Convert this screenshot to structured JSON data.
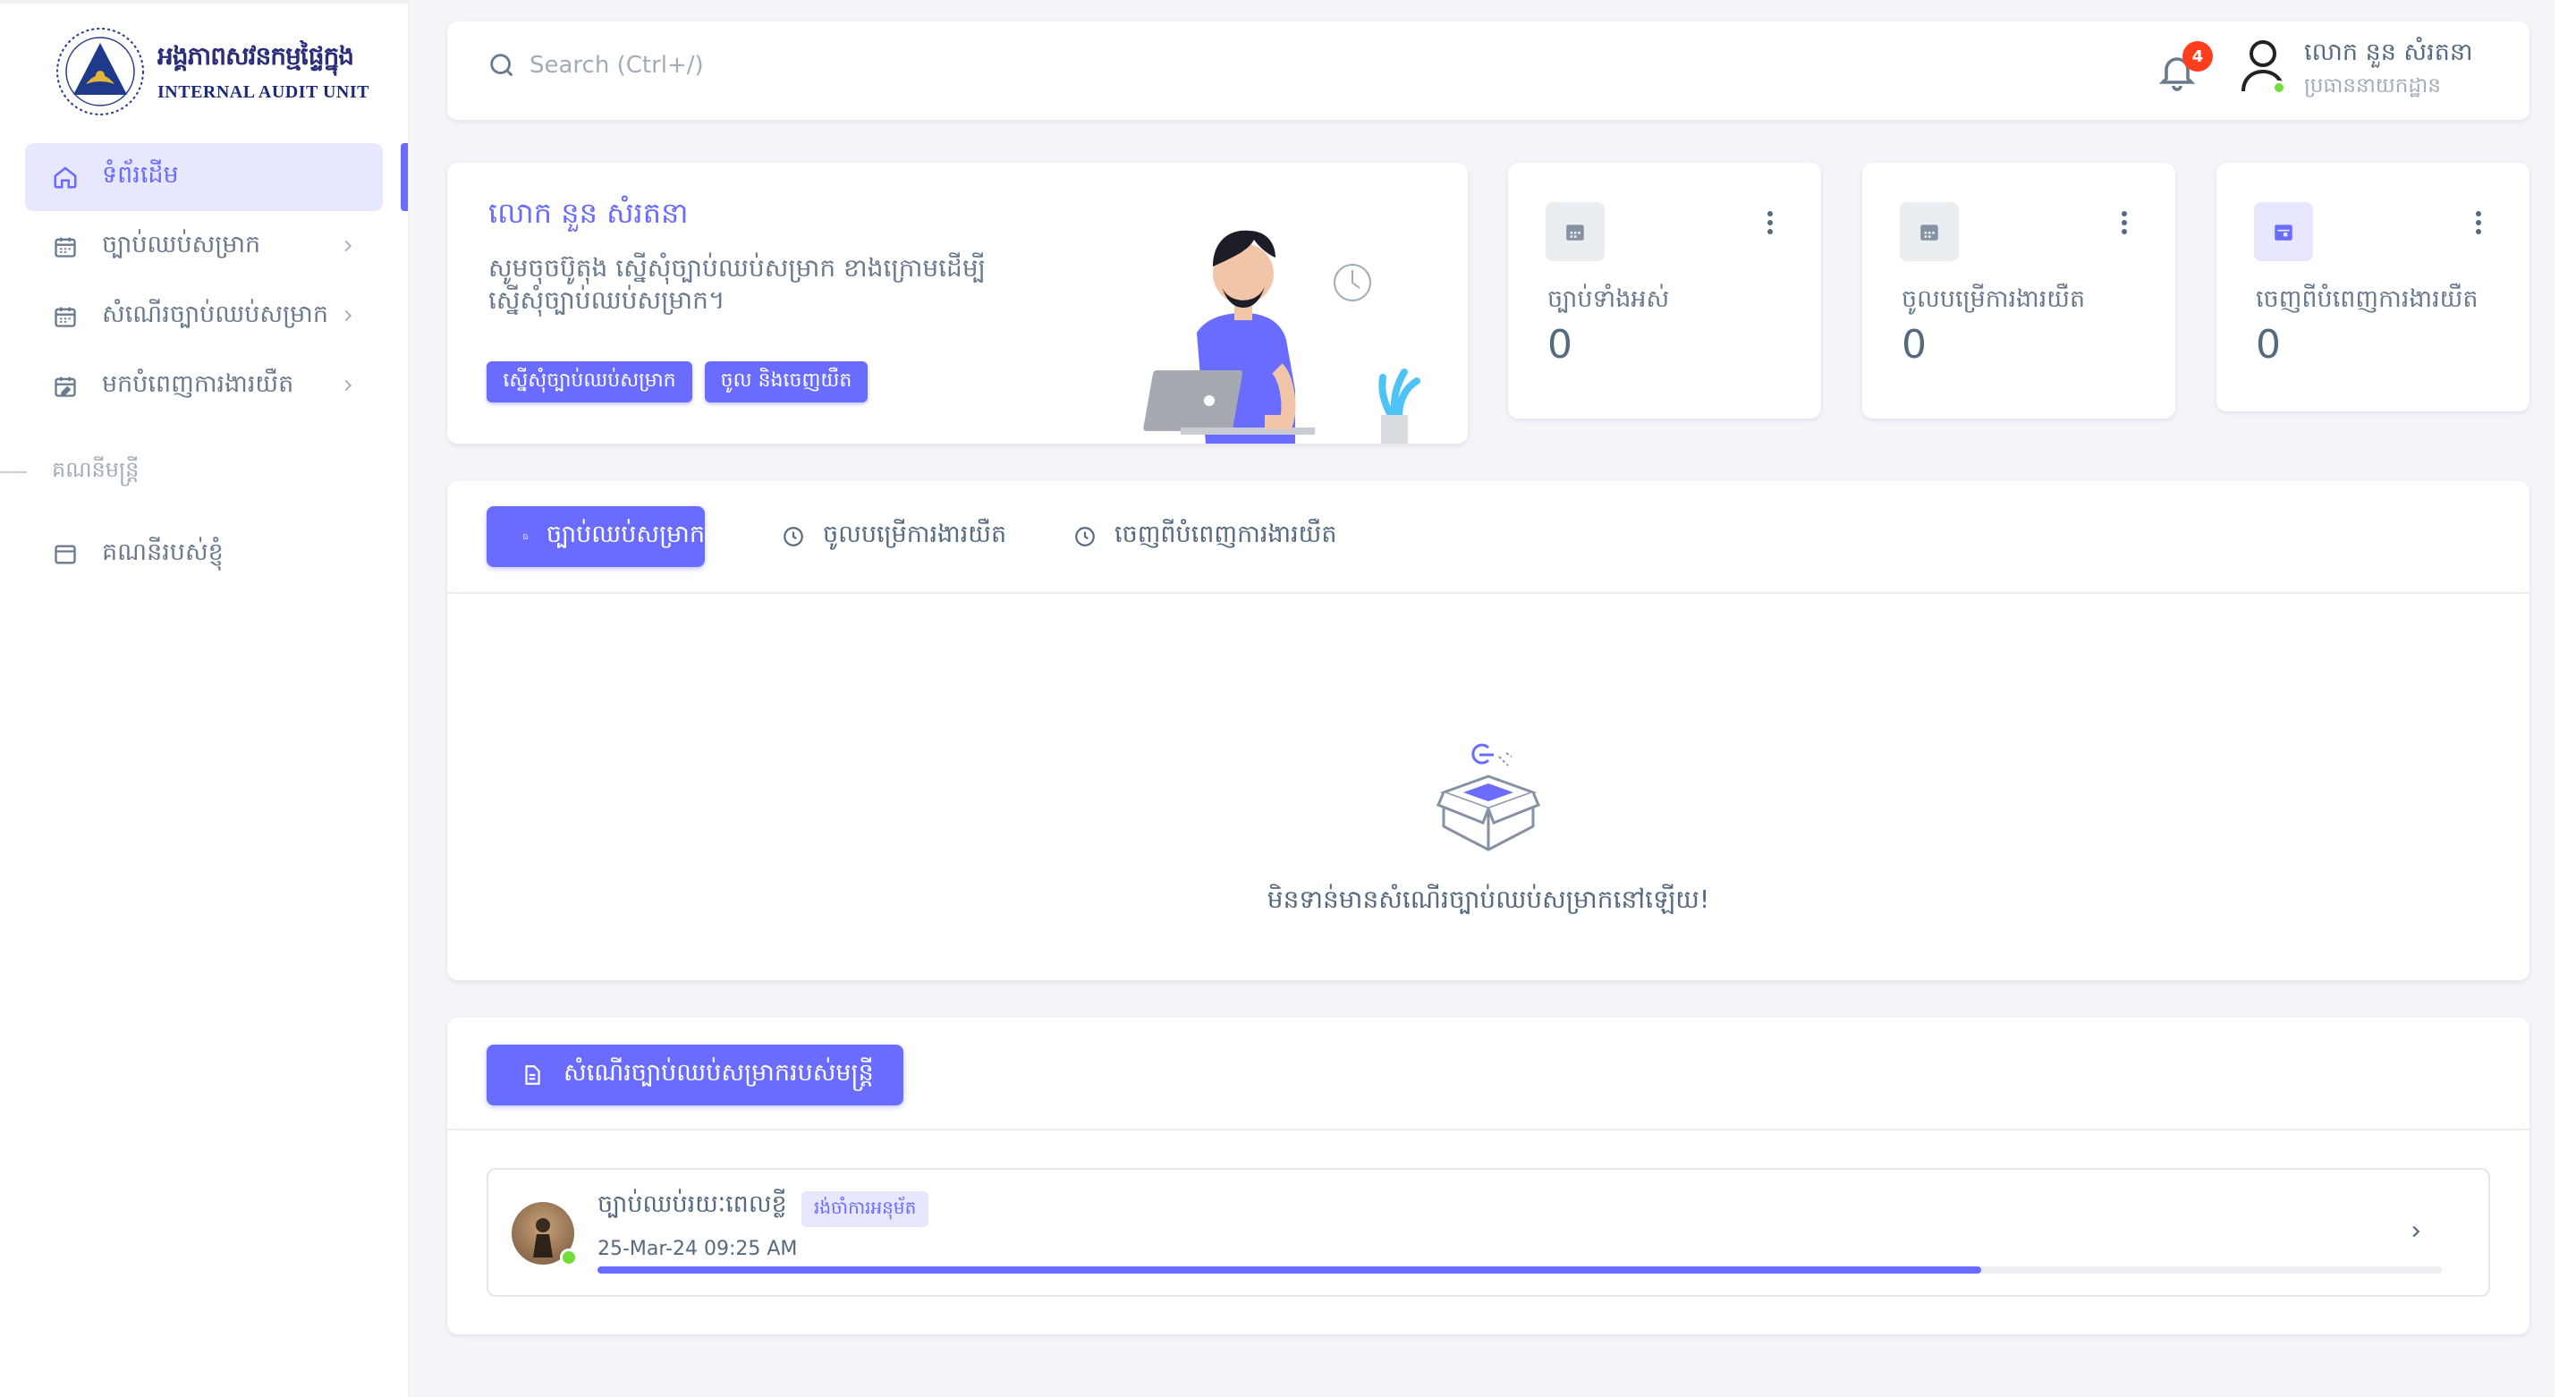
{
  "brand": {
    "name_kh": "អង្គភាពសវនកម្មផ្ទៃក្នុង",
    "name_en": "INTERNAL AUDIT UNIT",
    "logo_ring_text": "INTERNAL AUDIT UNIT"
  },
  "sidebar": {
    "items": [
      {
        "label": "ទំព័រដើម",
        "icon": "home-icon",
        "active": true
      },
      {
        "label": "ច្បាប់ឈប់សម្រាក",
        "icon": "calendar-icon",
        "arrow": true
      },
      {
        "label": "សំណើរច្បាប់ឈប់សម្រាក",
        "icon": "calendar-icon",
        "arrow": true
      },
      {
        "label": "មកបំពេញការងារយឺត",
        "icon": "calendar-edit-icon",
        "arrow": true
      }
    ],
    "section_header": "គណនីមន្ត្រី",
    "account_items": [
      {
        "label": "គណនីរបស់ខ្ញុំ",
        "icon": "window-icon"
      }
    ]
  },
  "navbar": {
    "search_placeholder": "Search (Ctrl+/)",
    "notification_count": "4",
    "user_name": "លោក នួន សំរតនា",
    "user_role": "ប្រធាននាយកដ្ឋាន"
  },
  "welcome": {
    "title": "លោក នួន សំរតនា",
    "subtitle": "សូមចុចប៊ូតុង ស្នើសុំច្បាប់ឈប់សម្រាក ខាងក្រោមដើម្បីស្នើសុំច្បាប់ឈប់សម្រាក។",
    "button_request": "ស្នើសុំច្បាប់ឈប់សម្រាក",
    "button_checkin": "ចូល និងចេញយឺត"
  },
  "stats": [
    {
      "label": "ច្បាប់ទាំងអស់",
      "value": "0",
      "icon": "calendar-icon"
    },
    {
      "label": "ចូលបម្រើការងារយឺត",
      "value": "0",
      "icon": "calendar-icon"
    },
    {
      "label": "ចេញពីបំពេញការងារយឺត",
      "value": "0",
      "icon": "calendar-check-icon"
    }
  ],
  "tabs": {
    "items": [
      {
        "label": "ច្បាប់ឈប់សម្រាក",
        "icon": "document-icon",
        "active": true
      },
      {
        "label": "ចូលបម្រើការងារយឺត",
        "icon": "clock-icon"
      },
      {
        "label": "ចេញពីបំពេញការងារយឺត",
        "icon": "clock-icon"
      }
    ],
    "empty_text": "មិនទាន់មានសំណើរច្បាប់ឈប់សម្រាកនៅឡើយ!"
  },
  "requests": {
    "button_label": "សំណើរច្បាប់ឈប់សម្រាករបស់មន្ត្រី",
    "items": [
      {
        "title": "ច្បាប់ឈប់រយៈពេលខ្លី",
        "badge": "រង់ចាំការអនុម័ត",
        "date": "25-Mar-24 09:25 AM",
        "progress": 0.75
      }
    ]
  },
  "colors": {
    "primary": "#696cff",
    "primary_light": "#e7e7ff",
    "danger": "#ff3e1d",
    "success": "#71dd37",
    "text": "#566a7f"
  }
}
